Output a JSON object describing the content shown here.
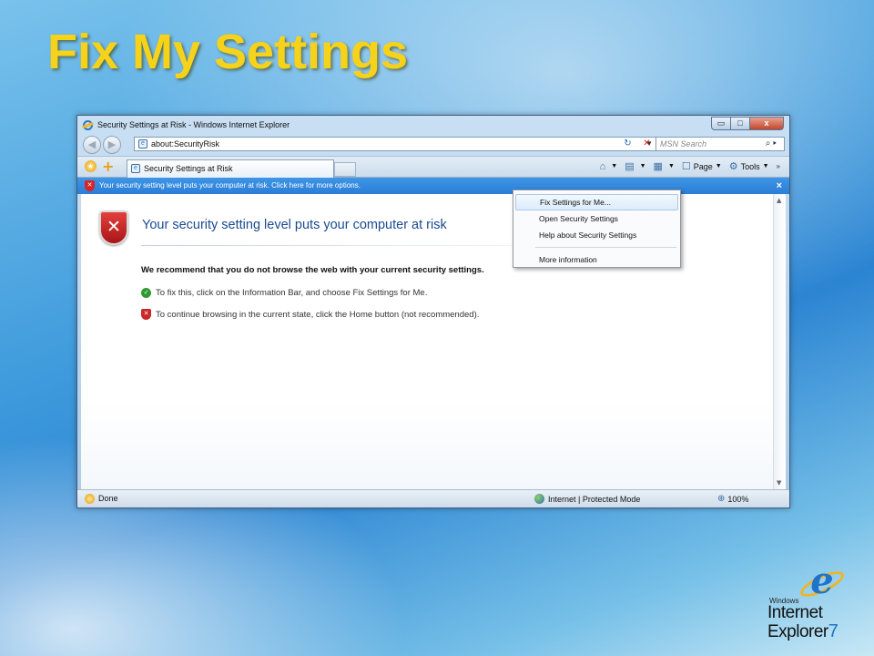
{
  "slide": {
    "title": "Fix My Settings"
  },
  "window": {
    "title": "Security Settings at Risk - Windows Internet Explorer",
    "caption": {
      "minimize": "▭",
      "maximize": "□",
      "close": "x"
    }
  },
  "address": {
    "url": "about:SecurityRisk",
    "search_placeholder": "MSN Search"
  },
  "tabs": [
    {
      "label": "Security Settings at Risk"
    }
  ],
  "commandbar": {
    "page_label": "Page",
    "tools_label": "Tools"
  },
  "infobar": {
    "text": "Your security setting level puts your computer at risk. Click here for more options."
  },
  "content": {
    "heading": "Your security setting level puts your computer at risk",
    "recommendation": "We recommend that you do not browse the web with your current security settings.",
    "bullets": [
      "To fix this, click on the Information Bar, and choose Fix Settings for Me.",
      "To continue browsing in the current state, click the Home button (not recommended)."
    ]
  },
  "menu": {
    "items": [
      {
        "label": "Fix Settings for Me..."
      },
      {
        "label": "Open Security Settings"
      },
      {
        "label": "Help about Security Settings"
      },
      {
        "label": "More information"
      }
    ]
  },
  "status": {
    "text": "Done",
    "zone": "Internet | Protected Mode",
    "zoom": "100%"
  },
  "brand": {
    "windows": "Windows",
    "line1": "Internet",
    "line2": "Explorer",
    "version": "7"
  },
  "colors": {
    "title_yellow": "#f7d21a",
    "infobar_blue": "#2a7dd6",
    "heading_blue": "#1a4a8f",
    "danger_red": "#c9282a"
  }
}
